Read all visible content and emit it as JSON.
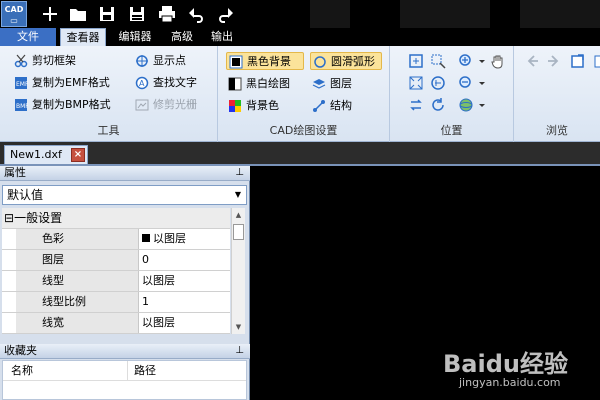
{
  "app": {
    "logo_text": "CAD"
  },
  "tabs": [
    {
      "label": "文件"
    },
    {
      "label": "查看器"
    },
    {
      "label": "编辑器"
    },
    {
      "label": "高级"
    },
    {
      "label": "输出"
    }
  ],
  "ribbon": {
    "tools": {
      "label": "工具",
      "items": [
        {
          "label": "剪切框架"
        },
        {
          "label": "复制为EMF格式"
        },
        {
          "label": "复制为BMP格式"
        },
        {
          "label": "显示点"
        },
        {
          "label": "查找文字"
        },
        {
          "label": "修剪光栅"
        }
      ]
    },
    "cad_settings": {
      "label": "CAD绘图设置",
      "items": [
        {
          "label": "黑色背景"
        },
        {
          "label": "黑白绘图"
        },
        {
          "label": "背景色"
        },
        {
          "label": "圆滑弧形"
        },
        {
          "label": "图层"
        },
        {
          "label": "结构"
        }
      ]
    },
    "position": {
      "label": "位置"
    },
    "browse": {
      "label": "浏览"
    }
  },
  "document_tab": {
    "label": "New1.dxf"
  },
  "properties_panel": {
    "title": "属性",
    "combo_value": "默认值",
    "category": "一般设置",
    "rows": [
      {
        "name": "色彩",
        "value": "以图层",
        "swatch": "#000000"
      },
      {
        "name": "图层",
        "value": "0"
      },
      {
        "name": "线型",
        "value": "以图层"
      },
      {
        "name": "线型比例",
        "value": "1"
      },
      {
        "name": "线宽",
        "value": "以图层"
      }
    ]
  },
  "favorites_panel": {
    "title": "收藏夹",
    "columns": [
      "名称",
      "路径"
    ]
  },
  "watermark": {
    "brand": "Baidu经验",
    "url": "jingyan.baidu.com"
  }
}
